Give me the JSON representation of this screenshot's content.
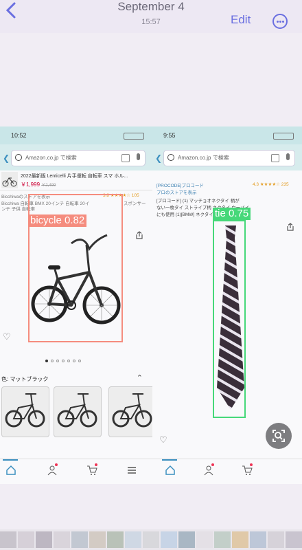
{
  "header": {
    "title": "September 4",
    "time": "15:57",
    "edit_label": "Edit"
  },
  "left_screen": {
    "status_time": "10:52",
    "search_text": "Amazon.co.jp で検索",
    "product_title": "2022最新版 Lenticelli 片手運転 自転車 スマ ホル...",
    "price": "￥1,999",
    "price_old": "￥2,499",
    "store_line": "Bicchiwaのストアを表示",
    "rating": "3.8 ★★★★☆ 105",
    "sponsored": "スポンサー",
    "desc_line": "Bicchiwa 自転車 BMX 20インチ 自転車 20イ",
    "desc_line2": "ンチ 子供 自転車",
    "color_label": "色: マットブラック"
  },
  "right_screen": {
    "status_time": "9:55",
    "search_text": "Amazon.co.jp で検索",
    "brand_line": "[PROCODE]プロコード",
    "rating": "4.3 ★★★★☆ 235",
    "store_line": "プロのストアを表示",
    "desc_line": "[プロコード] (1) マッチョオネクタイ 柄が",
    "desc_line2": "ない一枚タイ ストライプ柄 ネクタイ ウーバイ",
    "desc_line3": "にも使用 (1)[BMW] ネクタイ"
  },
  "detections": [
    {
      "label": "bicycle 0.82",
      "color": "#f58c7e"
    },
    {
      "label": "tie 0.75",
      "color": "#46d879"
    }
  ],
  "icons": [
    "back-chevron-icon",
    "more-ellipsis-icon",
    "search-icon",
    "camera-icon",
    "mic-icon",
    "share-icon",
    "heart-icon",
    "home-icon",
    "account-icon",
    "cart-icon",
    "menu-icon",
    "visual-lookup-icon"
  ],
  "colors": {
    "accent": "#6a6fe0",
    "bike_box": "#f58c7e",
    "tie_box": "#46d879"
  }
}
